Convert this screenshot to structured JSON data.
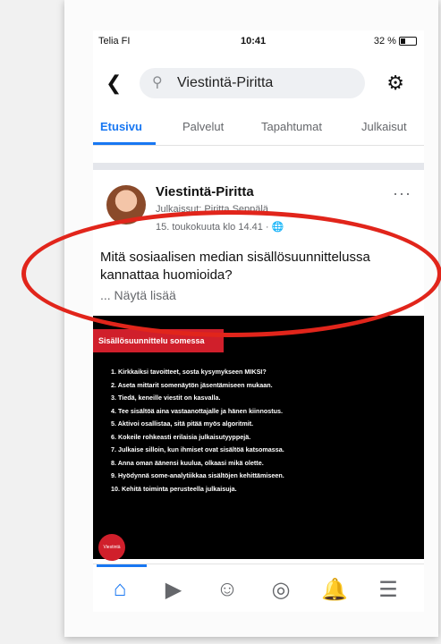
{
  "status_bar": {
    "carrier": "Telia FI",
    "time": "10:41",
    "battery": "32 %"
  },
  "header": {
    "back_icon": "chevron-left-icon",
    "search_text": "Viestintä-Piritta",
    "settings_icon": "gear-icon"
  },
  "tabs": [
    {
      "label": "Etusivu",
      "active": true
    },
    {
      "label": "Palvelut"
    },
    {
      "label": "Tapahtumat"
    },
    {
      "label": "Julkaisut"
    }
  ],
  "post": {
    "page_name": "Viestintä-Piritta",
    "published_by": "Julkaissut: Piritta Seppälä",
    "timestamp": "15. toukokuuta klo 14.41 · 🌐",
    "more_icon": "···",
    "text": "Mitä sosiaalisen median sisällösuunnittelussa kannattaa huomioida?",
    "show_more": "... Näytä lisää"
  },
  "image": {
    "banner": "Sisällösuunnittelu somessa",
    "items": [
      "1. Kirkkaiksi tavoitteet, sosta kysymykseen MIKSI?",
      "2. Aseta mittarit somenäytön jäsentämiseen mukaan.",
      "3. Tiedä, keneille viestit on kasvalla.",
      "4. Tee sisältöä aina vastaanottajalle ja hänen kiinnostus.",
      "5. Aktivoi osallistaa, sitä pitää myös algoritmit.",
      "6. Kokeile rohkeasti erilaisia julkaisutyyppejä.",
      "7. Julkaise silloin, kun ihmiset ovat sisältöä katsomassa.",
      "8. Anna oman äänensi kuulua, olkaasi mikä olette.",
      "9. Hyödynnä some-analytiikkaa sisältöjen kehittämiseen.",
      "10. Kehitä toiminta perusteella julkaisuja."
    ],
    "logo_text": "Viestintä Piritta"
  },
  "bottom_nav": [
    {
      "name": "home-icon",
      "glyph": "⌂",
      "active": true
    },
    {
      "name": "video-icon",
      "glyph": "▶"
    },
    {
      "name": "profile-icon",
      "glyph": "☺"
    },
    {
      "name": "groups-icon",
      "glyph": "◎"
    },
    {
      "name": "notifications-icon",
      "glyph": "🔔"
    },
    {
      "name": "menu-icon",
      "glyph": "☰"
    }
  ],
  "annotation_color": "#e1251b",
  "accent_color": "#1877f2"
}
